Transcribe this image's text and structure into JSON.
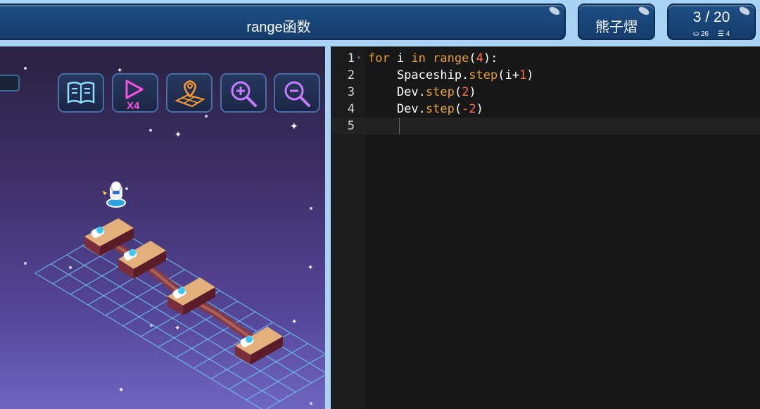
{
  "header": {
    "title": "range函数",
    "user_name": "熊子熠",
    "progress": "3 / 20",
    "stat_left": "⛀ 26",
    "stat_right": "☰ 4"
  },
  "toolbar": {
    "buttons": [
      {
        "name": "guide-book",
        "icon": "book-icon"
      },
      {
        "name": "play-speed-x4",
        "icon": "play-x4-icon"
      },
      {
        "name": "map-view",
        "icon": "map-pin-icon"
      },
      {
        "name": "zoom-in",
        "icon": "zoom-in-icon"
      },
      {
        "name": "zoom-out",
        "icon": "zoom-out-icon"
      }
    ],
    "speed_label": "X4"
  },
  "editor": {
    "lines": [
      {
        "n": "1",
        "tokens": [
          [
            "kw",
            "for"
          ],
          [
            "plain",
            " i "
          ],
          [
            "kw",
            "in"
          ],
          [
            "plain",
            " "
          ],
          [
            "fn",
            "range"
          ],
          [
            "plain",
            "("
          ],
          [
            "num",
            "4"
          ],
          [
            "plain",
            "):"
          ]
        ]
      },
      {
        "n": "2",
        "tokens": [
          [
            "plain",
            "    Spaceship."
          ],
          [
            "fn",
            "step"
          ],
          [
            "plain",
            "(i+"
          ],
          [
            "num",
            "1"
          ],
          [
            "plain",
            ")"
          ]
        ]
      },
      {
        "n": "3",
        "tokens": [
          [
            "plain",
            "    Dev."
          ],
          [
            "fn",
            "step"
          ],
          [
            "plain",
            "("
          ],
          [
            "num",
            "2"
          ],
          [
            "plain",
            ")"
          ]
        ]
      },
      {
        "n": "4",
        "tokens": [
          [
            "plain",
            "    Dev."
          ],
          [
            "fn",
            "step"
          ],
          [
            "plain",
            "("
          ],
          [
            "num",
            "-2"
          ],
          [
            "plain",
            ")"
          ]
        ]
      },
      {
        "n": "5",
        "tokens": []
      }
    ]
  },
  "colors": {
    "topbar_bg": "#a9d3f5",
    "pill_bg": "#1e4f86",
    "editor_bg": "#181818",
    "keyword": "#e6a23c",
    "number": "#ff6f4a"
  }
}
